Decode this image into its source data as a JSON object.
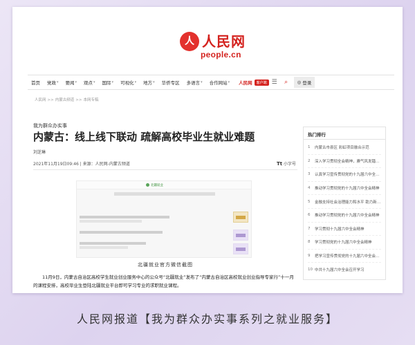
{
  "logo": {
    "mark": "人",
    "text_cn": "人民网",
    "text_en": "people.cn"
  },
  "nav": {
    "items": [
      {
        "label": "首页",
        "caret": false
      },
      {
        "label": "党政",
        "caret": true
      },
      {
        "label": "要闻",
        "caret": true
      },
      {
        "label": "观点",
        "caret": true
      },
      {
        "label": "国际",
        "caret": true
      },
      {
        "label": "可视化",
        "caret": true
      },
      {
        "label": "地方",
        "caret": true
      },
      {
        "label": "华侨专区",
        "caret": false
      },
      {
        "label": "多语言",
        "caret": true
      },
      {
        "label": "合作网站",
        "caret": true
      }
    ],
    "brand_label": "人民网",
    "brand_badge": "客户端",
    "menu_icon": "☰",
    "search_icon": "⌕",
    "login_icon": "◎",
    "login_label": "登录"
  },
  "breadcrumb": [
    "人民网",
    ">>",
    "内蒙古频道",
    ">>",
    "本网专稿"
  ],
  "article": {
    "kicker": "我为群众办实事",
    "title": "内蒙古：线上线下联动 疏解高校毕业生就业难题",
    "author": "刘芝琳",
    "meta": "2021年11月19日09:46 | 来源：人民网-内蒙古频道",
    "font_icon": "Tt",
    "font_label": "小字号",
    "embedded_header": "北疆就业",
    "caption": "北疆就业官方微信截图",
    "body": "11月9日，内蒙古自治区高校学生就业创业服务中心的公众号“北疆就业”发布了“内蒙古自治区高校就业创业指导专家行”十一月的课程安排，高校毕业生登陆北疆就业平台即可学习专业的求职就业课程。"
  },
  "sidebar": {
    "title": "热门排行",
    "items": [
      {
        "num": "1",
        "text": "内蒙古市县区 彩虹项目融合示范"
      },
      {
        "num": "2",
        "text": "深入学习贯彻全会精神，赓气风发踏上新征程"
      },
      {
        "num": "3",
        "text": "认真学习宣传贯彻党的十九届六中全会精神"
      },
      {
        "num": "4",
        "text": "推动学习贯彻党的十九届六中全会精神"
      },
      {
        "num": "5",
        "text": "金融支持社会治理能力和水平 助力新发展"
      },
      {
        "num": "6",
        "text": "推动学习贯彻党的十九届六中全会精神"
      },
      {
        "num": "7",
        "text": "学习贯彻十九届六中全会精神"
      },
      {
        "num": "8",
        "text": "学习贯彻党的十九届六中全会精神"
      },
      {
        "num": "9",
        "text": "把学习宣传贯彻党的十九届六中全会精神"
      },
      {
        "num": "10",
        "text": "中共十九届六中全会召开学习"
      }
    ]
  },
  "banner": "人民网报道【我为群众办实事系列之就业服务】"
}
